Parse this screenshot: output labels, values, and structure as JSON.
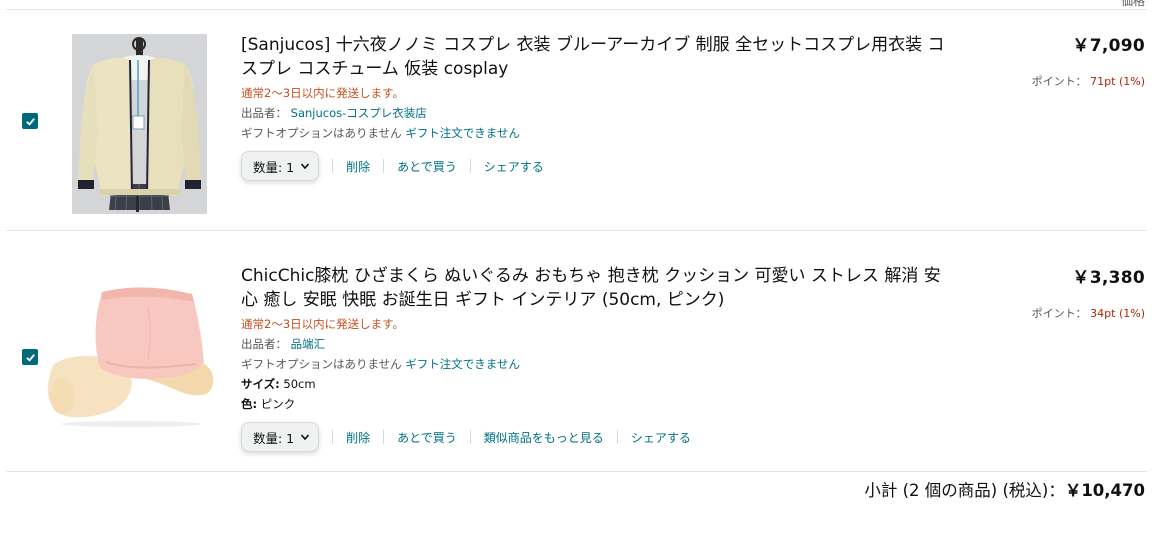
{
  "header": {
    "price_column": "価格"
  },
  "items": [
    {
      "title": "[Sanjucos] 十六夜ノノミ コスプレ 衣装 ブルーアーカイブ 制服 全セットコスプレ用衣装 コスプレ コスチューム 仮装 cosplay",
      "stock": "通常2～3日以内に発送します。",
      "seller_label": "出品者：",
      "seller": "Sanjucos-コスプレ衣装店",
      "gift_note": "ギフトオプションはありません",
      "gift_link": "ギフト注文できません",
      "quantity": "数量: 1",
      "actions": [
        "削除",
        "あとで買う",
        "シェアする"
      ],
      "price": "￥7,090",
      "points_label": "ポイント：",
      "points_value": "71pt (1%)",
      "selected": true
    },
    {
      "title": "ChicChic膝枕 ひざまくら ぬいぐるみ おもちゃ 抱き枕 クッション 可愛い ストレス 解消 安心 癒し 安眠 快眠 お誕生日 ギフト インテリア (50cm, ピンク)",
      "stock": "通常2～3日以内に発送します。",
      "seller_label": "出品者：",
      "seller": "品端汇",
      "gift_note": "ギフトオプションはありません",
      "gift_link": "ギフト注文できません",
      "size_label": "サイズ:",
      "size_value": "50cm",
      "color_label": "色:",
      "color_value": "ピンク",
      "quantity": "数量: 1",
      "actions": [
        "削除",
        "あとで買う",
        "類似商品をもっと見る",
        "シェアする"
      ],
      "price": "￥3,380",
      "points_label": "ポイント：",
      "points_value": "34pt (1%)",
      "selected": true
    }
  ],
  "subtotal": {
    "label": "小計 (2 個の商品) (税込)：",
    "amount": "￥10,470"
  },
  "colors": {
    "checkbox": "#00697b",
    "link": "#007185",
    "stock": "#c7511f",
    "points": "#b12704"
  },
  "icons": [
    "check-icon",
    "chevron-down-icon"
  ]
}
